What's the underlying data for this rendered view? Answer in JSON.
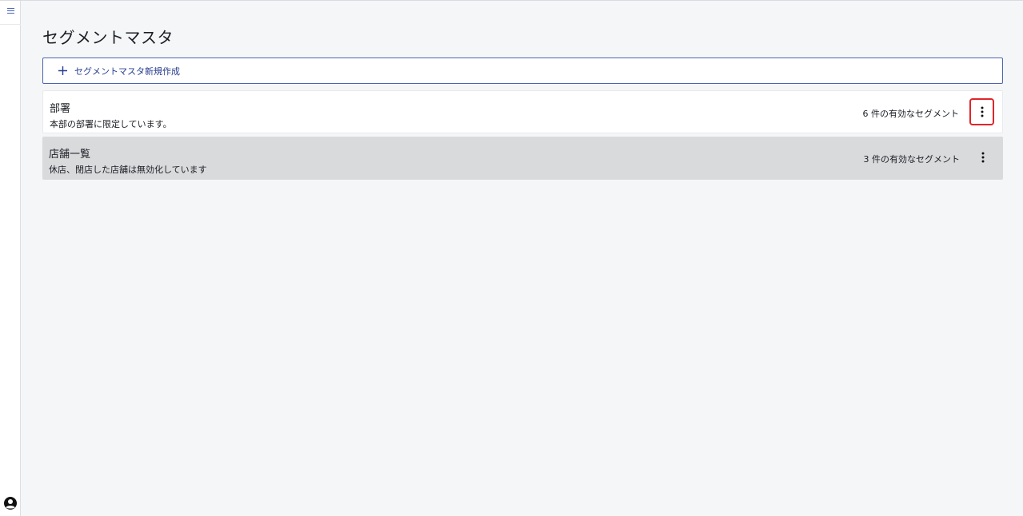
{
  "page": {
    "title": "セグメントマスタ"
  },
  "actions": {
    "new_button_label": "セグメントマスタ新規作成"
  },
  "segments": [
    {
      "name": "部署",
      "description": "本部の部署に限定しています。",
      "count_text": "6 件の有効なセグメント",
      "state": "normal",
      "menu_highlighted": true
    },
    {
      "name": "店舗一覧",
      "description": "休店、閉店した店舗は無効化しています",
      "count_text": "3 件の有効なセグメント",
      "state": "hover",
      "menu_highlighted": false
    }
  ],
  "icons": {
    "menu": "hamburger-menu-icon",
    "user": "user-account-icon",
    "add": "plus-icon",
    "more": "more-vertical-icon"
  },
  "colors": {
    "accent": "#273d8f",
    "highlight": "#e0252b",
    "background": "#f5f6f8",
    "hover_row": "#d9dadc"
  }
}
